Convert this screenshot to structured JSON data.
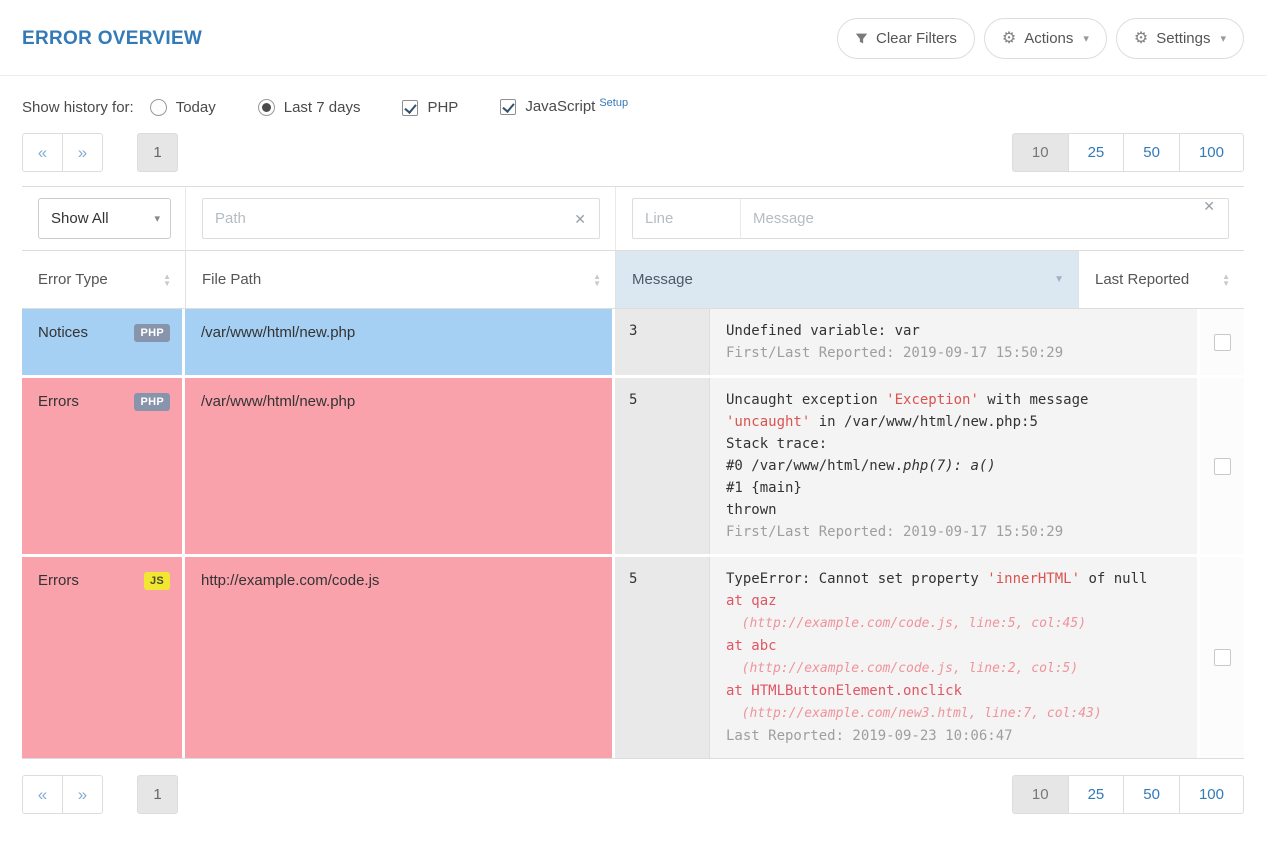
{
  "colors": {
    "accent": "#337ab7",
    "row_notice": "#a6d0f3",
    "row_error": "#f9a2ac",
    "badge_php": "#8894ac",
    "badge_js": "#f1e733",
    "msg_red": "#d9534f",
    "msg_at": "#e25563",
    "msg_loc": "#ef939b",
    "muted": "#9e9e9e",
    "sorted_bg": "#dbe8f2"
  },
  "icons": {
    "clear": "✕",
    "caret": "▾",
    "gear": "⚙",
    "sort_up": "▲",
    "sort_down": "▼"
  },
  "header": {
    "title": "ERROR OVERVIEW",
    "clear_filters_label": "Clear Filters",
    "actions_label": "Actions",
    "settings_label": "Settings"
  },
  "history_filter": {
    "label": "Show history for:",
    "radio_today": "Today",
    "radio_last7": "Last 7 days",
    "check_php": "PHP",
    "check_js": "JavaScript",
    "setup_link": "Setup"
  },
  "pagination": {
    "prev": "«",
    "next": "»",
    "current_page": "1",
    "sizes": [
      "10",
      "25",
      "50",
      "100"
    ],
    "active_size": "10"
  },
  "table": {
    "filters": {
      "type_select_value": "Show All",
      "path_placeholder": "Path",
      "line_placeholder": "Line",
      "message_placeholder": "Message"
    },
    "headers": {
      "error_type": "Error Type",
      "file_path": "File Path",
      "message": "Message",
      "last_reported": "Last Reported"
    },
    "rows": [
      {
        "type": "Notices",
        "badge": "PHP",
        "file_path": "/var/www/html/new.php",
        "line": "3",
        "message_lines": [
          [
            {
              "t": "Undefined variable: var",
              "c": "plain"
            }
          ],
          [
            {
              "t": "First/Last Reported: 2019-09-17 15:50:29",
              "c": "muted"
            }
          ]
        ]
      },
      {
        "type": "Errors",
        "badge": "PHP",
        "file_path": "/var/www/html/new.php",
        "line": "5",
        "message_lines": [
          [
            {
              "t": "Uncaught exception ",
              "c": "plain"
            },
            {
              "t": "'Exception'",
              "c": "red"
            },
            {
              "t": " with message",
              "c": "plain"
            }
          ],
          [
            {
              "t": "'uncaught'",
              "c": "red"
            },
            {
              "t": " in /var/www/html/new.php:5",
              "c": "plain"
            }
          ],
          [
            {
              "t": "Stack trace:",
              "c": "plain"
            }
          ],
          [
            {
              "t": "#0 /var/www/html/new.",
              "c": "plain"
            },
            {
              "t": "php(7): a()",
              "c": "italic"
            }
          ],
          [
            {
              "t": "#1 {main}",
              "c": "plain"
            }
          ],
          [
            {
              "t": "thrown",
              "c": "plain"
            }
          ],
          [
            {
              "t": "First/Last Reported: 2019-09-17 15:50:29",
              "c": "muted"
            }
          ]
        ]
      },
      {
        "type": "Errors",
        "badge": "JS",
        "file_path": "http://example.com/code.js",
        "line": "5",
        "message_lines": [
          [
            {
              "t": "TypeError: Cannot set property ",
              "c": "plain"
            },
            {
              "t": "'innerHTML'",
              "c": "red"
            },
            {
              "t": " of null",
              "c": "plain"
            }
          ],
          [
            {
              "t": "at qaz",
              "c": "at"
            }
          ],
          [
            {
              "t": "  (http://example.com/code.js, line:5, col:45)",
              "c": "loc"
            }
          ],
          [
            {
              "t": "at abc",
              "c": "at"
            }
          ],
          [
            {
              "t": "  (http://example.com/code.js, line:2, col:5)",
              "c": "loc"
            }
          ],
          [
            {
              "t": "at HTMLButtonElement.onclick",
              "c": "at"
            }
          ],
          [
            {
              "t": "  (http://example.com/new3.html, line:7, col:43)",
              "c": "loc"
            }
          ],
          [
            {
              "t": "Last Reported: 2019-09-23 10:06:47",
              "c": "muted"
            }
          ]
        ]
      }
    ]
  }
}
